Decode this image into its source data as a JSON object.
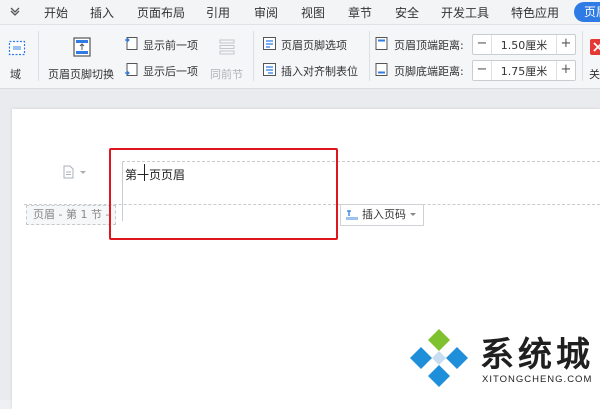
{
  "menu": {
    "tabs": [
      "开始",
      "插入",
      "页面布局",
      "引用",
      "审阅",
      "视图",
      "章节",
      "安全",
      "开发工具",
      "特色应用",
      "页眉"
    ]
  },
  "ribbon": {
    "field_label": "域",
    "switch_label": "页眉页脚切换",
    "prev_label": "显示前一项",
    "next_label": "显示后一项",
    "same_prev_label": "同前节",
    "options_label": "页眉页脚选项",
    "align_tab_label": "插入对齐制表位",
    "header_dist_label": "页眉顶端距离:",
    "header_dist_value": "1.50厘米",
    "footer_dist_label": "页脚底端距离:",
    "footer_dist_value": "1.75厘米",
    "close_label": "关"
  },
  "document": {
    "header_text": "第一页页眉",
    "header_tag": "页眉 - 第 1 节 -",
    "insert_page_number": "插入页码"
  },
  "watermark": {
    "title": "系统城",
    "subtitle": "XITONGCHENG.COM"
  },
  "colors": {
    "accent": "#2f7be6",
    "highlight_box": "#e0161e",
    "logo_blue": "#1e8fd8",
    "logo_green": "#7ec22f"
  }
}
